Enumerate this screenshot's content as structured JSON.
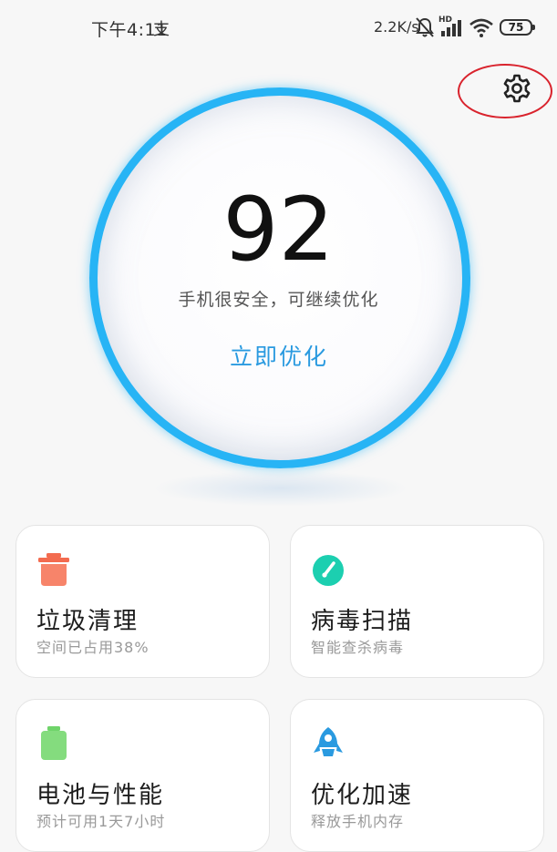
{
  "status_bar": {
    "time": "下午4:11",
    "pay_icon": "支",
    "net_speed": "2.2K/s",
    "hd_label": "HD",
    "battery": "75",
    "icons": [
      "mute-bell-icon",
      "signal-icon",
      "wifi-icon",
      "battery-icon"
    ]
  },
  "header": {
    "settings_icon": "gear-icon"
  },
  "score_panel": {
    "score": "92",
    "description": "手机很安全，可继续优化",
    "action_label": "立即优化",
    "ring_color": "#27b4f5",
    "action_color": "#2a9ae0"
  },
  "cards": [
    {
      "title": "垃圾清理",
      "subtitle": "空间已占用38%",
      "icon": "trash-icon",
      "color": "#f36b4f"
    },
    {
      "title": "病毒扫描",
      "subtitle": "智能查杀病毒",
      "icon": "shield-scan-icon",
      "color": "#1ccfb0"
    },
    {
      "title": "电池与性能",
      "subtitle": "预计可用1天7小时",
      "icon": "battery-icon",
      "color": "#6fd46a"
    },
    {
      "title": "优化加速",
      "subtitle": "释放手机内存",
      "icon": "rocket-icon",
      "color": "#2a9ae0"
    }
  ]
}
